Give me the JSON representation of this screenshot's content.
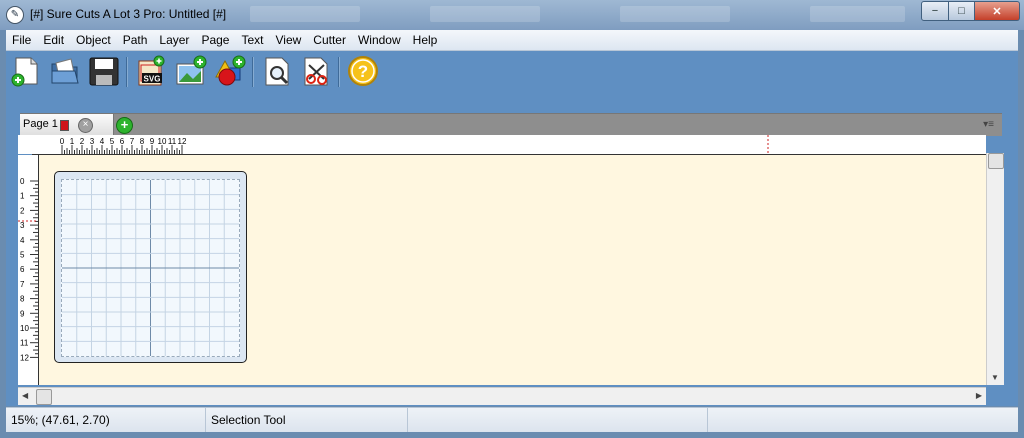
{
  "window": {
    "title": "[#] Sure Cuts A Lot 3 Pro: Untitled [#]",
    "minimize": "−",
    "maximize": "□",
    "close": "✕"
  },
  "menu": [
    "File",
    "Edit",
    "Object",
    "Path",
    "Layer",
    "Page",
    "Text",
    "View",
    "Cutter",
    "Window",
    "Help"
  ],
  "toolbar": {
    "buttons": [
      {
        "name": "new-document",
        "icon": "new-document-icon"
      },
      {
        "name": "open",
        "icon": "open-folder-icon"
      },
      {
        "name": "save",
        "icon": "floppy-disk-icon"
      },
      {
        "name": "import-svg",
        "icon": "svg-import-icon",
        "glyph": "SVG"
      },
      {
        "name": "import-image",
        "icon": "image-add-icon"
      },
      {
        "name": "add-shape",
        "icon": "shapes-add-icon"
      },
      {
        "name": "preview",
        "icon": "magnifier-page-icon"
      },
      {
        "name": "cut",
        "icon": "scissors-page-icon"
      },
      {
        "name": "help",
        "icon": "help-icon",
        "glyph": "?"
      }
    ]
  },
  "tabs": {
    "page_label": "Page 1",
    "close_glyph": "×",
    "add_glyph": "+",
    "menu_glyph": "▾≡",
    "page_color": "#d0141a"
  },
  "ruler": {
    "top_labels": [
      "0",
      "1",
      "2",
      "3",
      "4",
      "5",
      "6",
      "7",
      "8",
      "9",
      "10",
      "11",
      "12"
    ],
    "left_labels": [
      "0",
      "1",
      "2",
      "3",
      "4",
      "5",
      "6",
      "7",
      "8",
      "9",
      "10",
      "11",
      "12"
    ]
  },
  "colors": {
    "canvas": "#fff7e0",
    "accent": "#5f8fc2",
    "marker": "#cc2222"
  },
  "status": {
    "zoom_coords": "15%; (47.61, 2.70)",
    "tool": "Selection Tool"
  }
}
